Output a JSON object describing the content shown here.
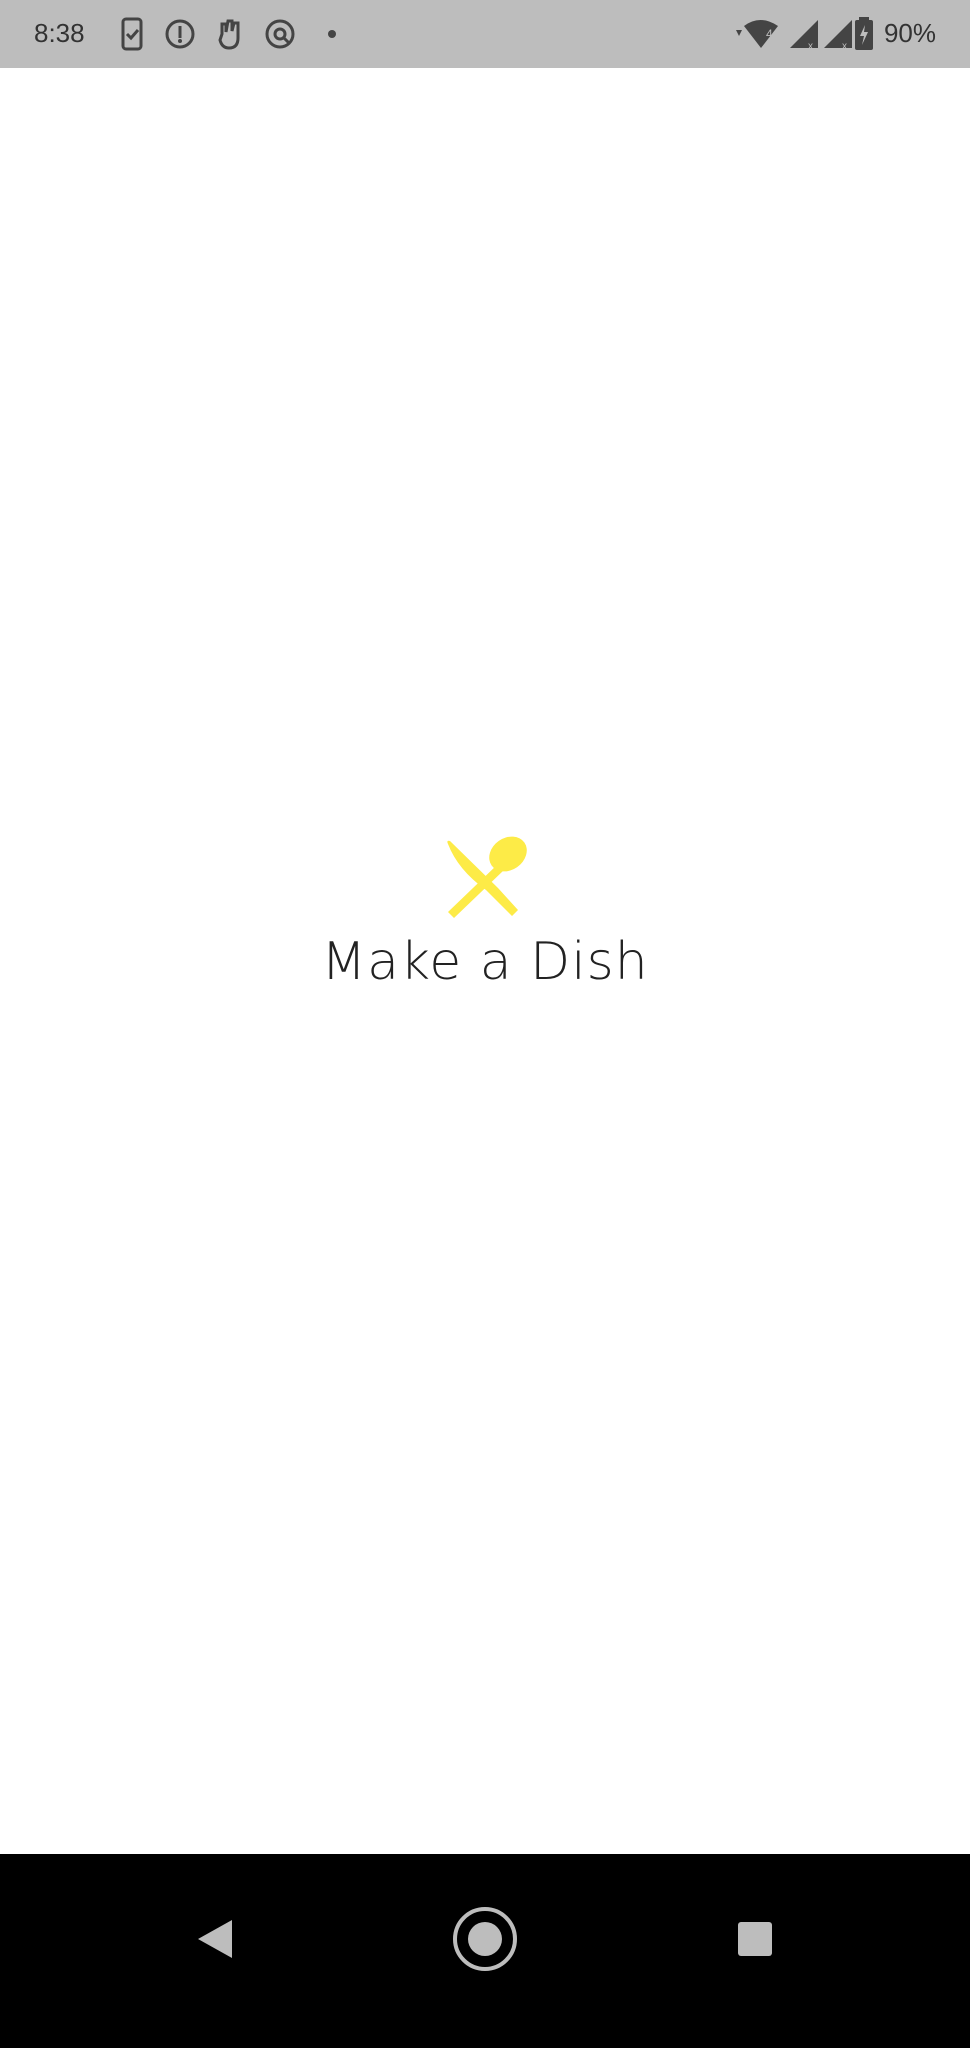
{
  "status_bar": {
    "time": "8:38",
    "battery_percent": "90%",
    "icons_left": [
      "phone-check-icon",
      "key-icon",
      "hand-icon",
      "at-sign-icon",
      "dot-icon"
    ],
    "icons_right": [
      "wifi-icon",
      "signal-icon",
      "signal-icon",
      "battery-icon"
    ]
  },
  "splash": {
    "app_name": "Make a Dish",
    "logo_icon": "knife-spoon-icon",
    "logo_color": "#FDEB47"
  },
  "nav_bar": {
    "buttons": [
      "back-icon",
      "home-icon",
      "recents-icon"
    ]
  }
}
